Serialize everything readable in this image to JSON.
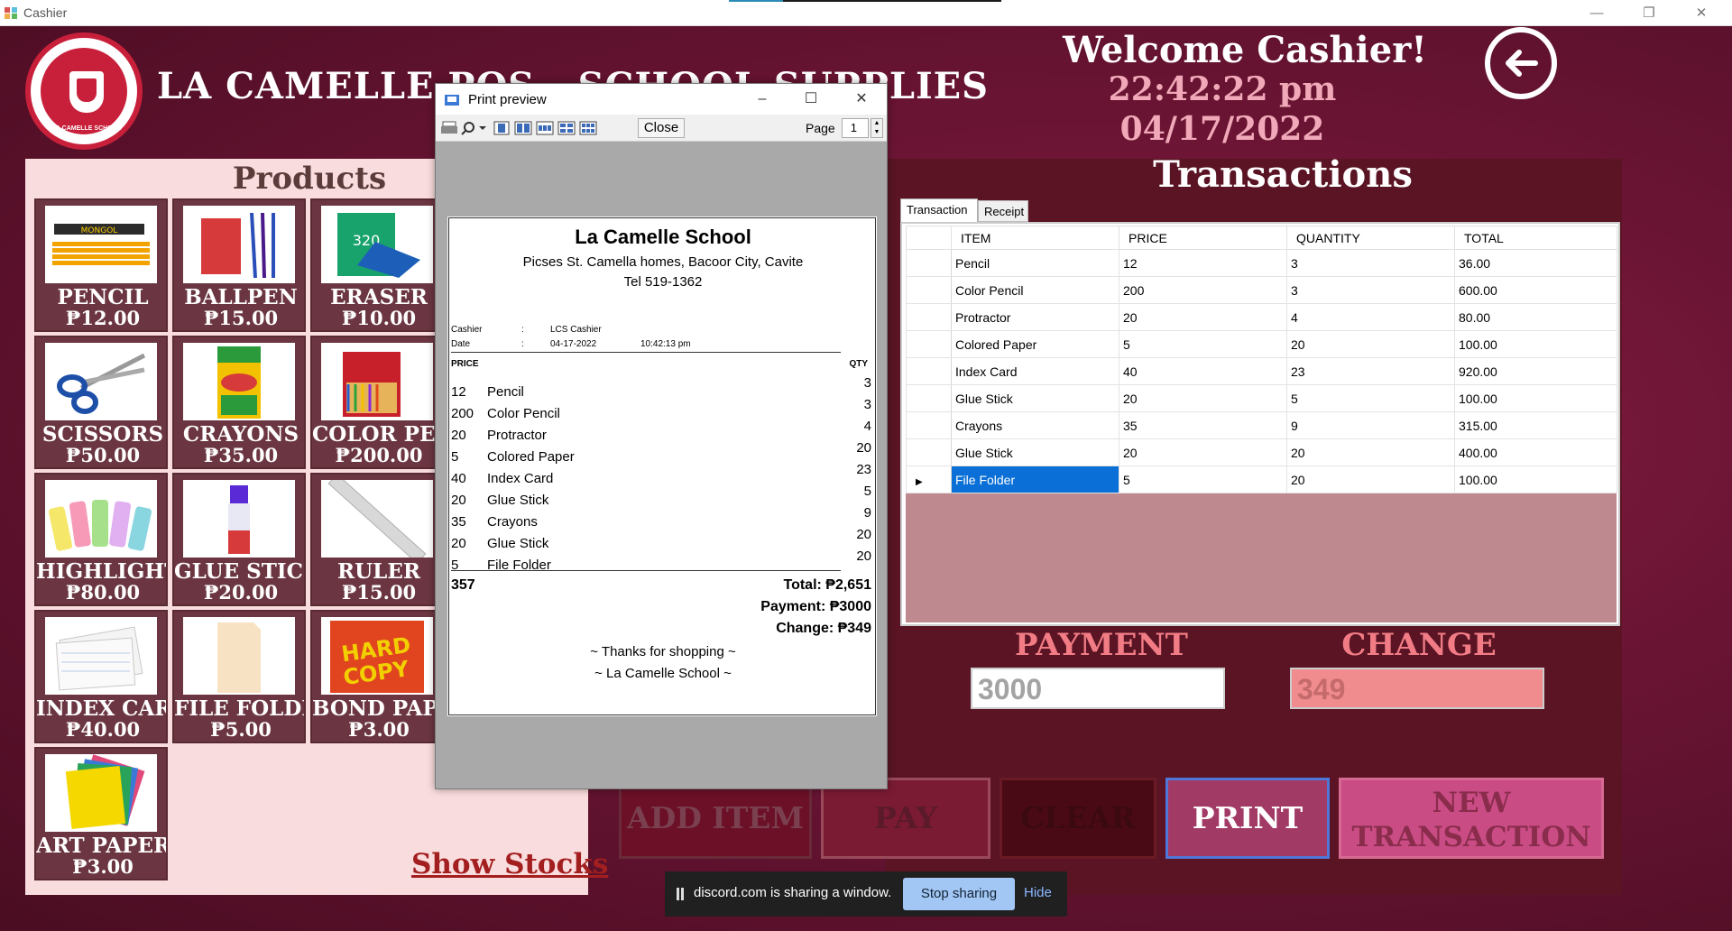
{
  "window": {
    "title": "Cashier",
    "min": "—",
    "max": "❐",
    "close": "✕"
  },
  "header": {
    "store_title": "LA CAMELLE POS - SCHOOL SUPPLIES",
    "logo_text": "LA CAMELLE SCHOOL",
    "welcome": "Welcome Cashier!",
    "time": "22:42:22 pm",
    "date": "04/17/2022"
  },
  "products": {
    "heading": "Products",
    "items": [
      {
        "name": "PENCIL",
        "price": "₱12.00",
        "icon": "pencil-icon"
      },
      {
        "name": "BALLPEN",
        "price": "₱15.00",
        "icon": "ballpen-icon"
      },
      {
        "name": "ERASER",
        "price": "₱10.00",
        "icon": "eraser-icon"
      },
      {
        "name": "SCISSORS",
        "price": "₱50.00",
        "icon": "scissors-icon"
      },
      {
        "name": "CRAYONS",
        "price": "₱35.00",
        "icon": "crayons-icon"
      },
      {
        "name": "COLOR PENCIL",
        "price": "₱200.00",
        "icon": "color-pencil-icon"
      },
      {
        "name": "HIGHLIGHTER",
        "price": "₱80.00",
        "icon": "highlighter-icon"
      },
      {
        "name": "GLUE STICK",
        "price": "₱20.00",
        "icon": "glue-stick-icon"
      },
      {
        "name": "RULER",
        "price": "₱15.00",
        "icon": "ruler-icon"
      },
      {
        "name": "INDEX CARD",
        "price": "₱40.00",
        "icon": "index-card-icon"
      },
      {
        "name": "FILE FOLDER",
        "price": "₱5.00",
        "icon": "file-folder-icon"
      },
      {
        "name": "BOND PAPER",
        "price": "₱3.00",
        "icon": "bond-paper-icon"
      },
      {
        "name": "ART PAPER",
        "price": "₱3.00",
        "icon": "art-paper-icon"
      }
    ],
    "show_stocks": "Show Stocks"
  },
  "transactions": {
    "heading": "Transactions",
    "tabs": [
      "Transaction",
      "Receipt"
    ],
    "columns": [
      "ITEM",
      "PRICE",
      "QUANTITY",
      "TOTAL"
    ],
    "rows": [
      {
        "item": "Pencil",
        "price": "12",
        "qty": "3",
        "total": "36.00"
      },
      {
        "item": "Color Pencil",
        "price": "200",
        "qty": "3",
        "total": "600.00"
      },
      {
        "item": "Protractor",
        "price": "20",
        "qty": "4",
        "total": "80.00"
      },
      {
        "item": "Colored Paper",
        "price": "5",
        "qty": "20",
        "total": "100.00"
      },
      {
        "item": "Index Card",
        "price": "40",
        "qty": "23",
        "total": "920.00"
      },
      {
        "item": "Glue Stick",
        "price": "20",
        "qty": "5",
        "total": "100.00"
      },
      {
        "item": "Crayons",
        "price": "35",
        "qty": "9",
        "total": "315.00"
      },
      {
        "item": "Glue Stick",
        "price": "20",
        "qty": "20",
        "total": "400.00"
      },
      {
        "item": "File Folder",
        "price": "5",
        "qty": "20",
        "total": "100.00",
        "selected": true
      }
    ],
    "payment_label": "PAYMENT",
    "payment_value": "3000",
    "change_label": "CHANGE",
    "change_value": "349"
  },
  "actions": {
    "add_item": "ADD ITEM",
    "pay": "PAY",
    "clear": "CLEAR",
    "print": "PRINT",
    "new_transaction": "NEW TRANSACTION"
  },
  "preview": {
    "title": "Print preview",
    "close_label": "Close",
    "page_label": "Page",
    "page_value": "1",
    "receipt": {
      "school": "La Camelle School",
      "address": "Picses St. Camella homes, Bacoor City, Cavite",
      "tel": "Tel 519-1362",
      "cashier_label": "Cashier",
      "cashier_sep": ":",
      "cashier_value": "LCS Cashier",
      "date_label": "Date",
      "date_sep": ":",
      "date_value": "04-17-2022",
      "time_value": "10:42:13 pm",
      "price_header": "PRICE",
      "qty_header": "QTY",
      "lines": [
        {
          "price": "12",
          "name": "Pencil",
          "qty": "3"
        },
        {
          "price": "200",
          "name": "Color Pencil",
          "qty": "3"
        },
        {
          "price": "20",
          "name": "Protractor",
          "qty": "4"
        },
        {
          "price": "5",
          "name": "Colored Paper",
          "qty": "20"
        },
        {
          "price": "40",
          "name": "Index Card",
          "qty": "23"
        },
        {
          "price": "20",
          "name": "Glue Stick",
          "qty": "5"
        },
        {
          "price": "35",
          "name": "Crayons",
          "qty": "9"
        },
        {
          "price": "20",
          "name": "Glue Stick",
          "qty": "20"
        },
        {
          "price": "5",
          "name": "File Folder",
          "qty": "20"
        }
      ],
      "sum_qty": "357",
      "total": "Total: ₱2,651",
      "payment": "Payment: ₱3000",
      "change": "Change: ₱349",
      "thanks": "~ Thanks for shopping ~",
      "footer": "~ La Camelle School ~"
    }
  },
  "share_bar": {
    "message": "discord.com is sharing a window.",
    "stop": "Stop sharing",
    "hide": "Hide"
  },
  "colors": {
    "background": "#6a1433",
    "accent_pink": "#f27c85",
    "selection": "#0a6fd6",
    "print_border": "#4f77d8"
  }
}
